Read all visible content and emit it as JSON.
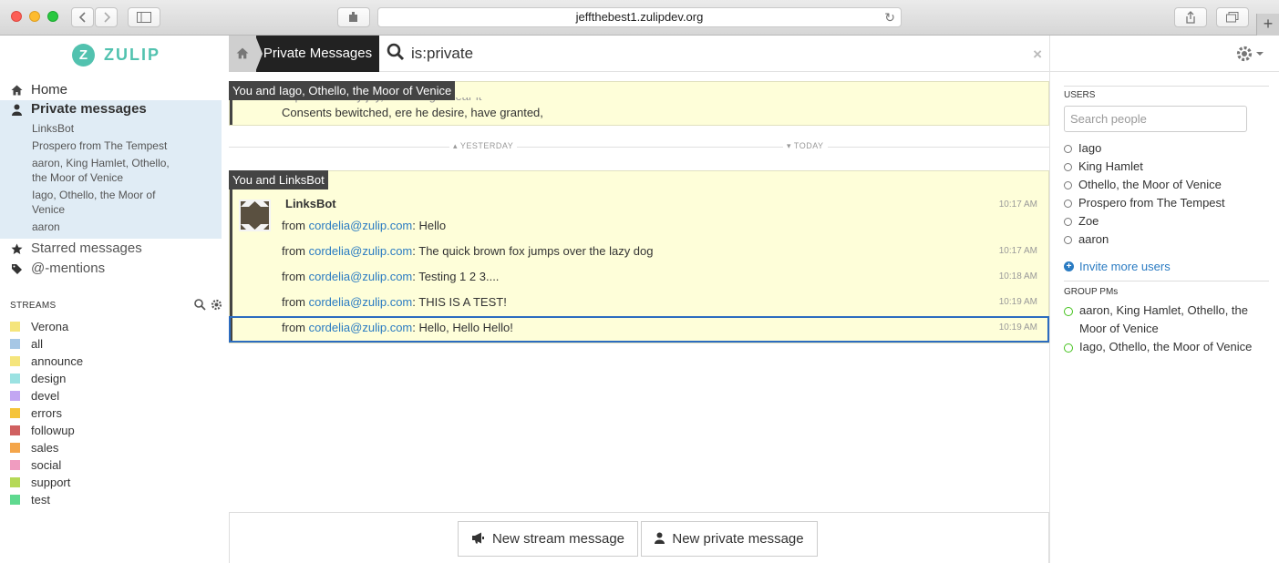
{
  "browser": {
    "url": "jeffthebest1.zulipdev.org",
    "back_icon": "chevron-left",
    "forward_icon": "chevron-right",
    "sidebar_icon": "sidebar",
    "reload_icon": "reload",
    "new_tab_icon": "plus"
  },
  "app": {
    "logo_letter": "Z",
    "name": "ZULIP"
  },
  "left_nav": {
    "home": "Home",
    "private_messages": "Private messages",
    "starred": "Starred messages",
    "mentions": "@-mentions",
    "pm_conversations": [
      "LinksBot",
      "Prospero from The Tempest",
      "aaron, King Hamlet, Othello, the Moor of Venice",
      "Iago, Othello, the Moor of Venice",
      "aaron"
    ]
  },
  "streams": {
    "header": "STREAMS",
    "items": [
      {
        "name": "Verona",
        "color": "#f5e57c"
      },
      {
        "name": "all",
        "color": "#a6c7e5"
      },
      {
        "name": "announce",
        "color": "#f5e57c"
      },
      {
        "name": "design",
        "color": "#9be2e2"
      },
      {
        "name": "devel",
        "color": "#c2a6f2"
      },
      {
        "name": "errors",
        "color": "#f5c43a"
      },
      {
        "name": "followup",
        "color": "#d06060"
      },
      {
        "name": "sales",
        "color": "#f4a54a"
      },
      {
        "name": "social",
        "color": "#f09cc0"
      },
      {
        "name": "support",
        "color": "#b5d957"
      },
      {
        "name": "test",
        "color": "#5fd98f"
      }
    ]
  },
  "topbar": {
    "tab_label": "Private Messages",
    "search_value": "is:private",
    "clear_icon": "×"
  },
  "messages": {
    "group1_recipients": "You and Iago, Othello, the Moor of Venice",
    "group1_partial": "Impatient of my joy, that I might hear it",
    "group1_last": "Consents bewitched, ere he desire, have granted,",
    "divider_left": "YESTERDAY",
    "divider_right": "TODAY",
    "group2_recipients": "You and LinksBot",
    "sender": "LinksBot",
    "rows": [
      {
        "prefix": "from ",
        "email": "cordelia@zulip.com",
        "text": ": Hello",
        "time": "10:17 AM"
      },
      {
        "prefix": "from ",
        "email": "cordelia@zulip.com",
        "text": ": The quick brown fox jumps over the lazy dog",
        "time": "10:17 AM"
      },
      {
        "prefix": "from ",
        "email": "cordelia@zulip.com",
        "text": ": Testing 1 2 3....",
        "time": "10:18 AM"
      },
      {
        "prefix": "from ",
        "email": "cordelia@zulip.com",
        "text": ": THIS IS A TEST!",
        "time": "10:19 AM"
      },
      {
        "prefix": "from ",
        "email": "cordelia@zulip.com",
        "text": ": Hello, Hello Hello!",
        "time": "10:19 AM"
      }
    ]
  },
  "compose": {
    "new_stream": "New stream message",
    "new_private": "New private message"
  },
  "right_sidebar": {
    "users_header": "USERS",
    "search_placeholder": "Search people",
    "users": [
      "Iago",
      "King Hamlet",
      "Othello, the Moor of Venice",
      "Prospero from The Tempest",
      "Zoe",
      "aaron"
    ],
    "invite": "Invite more users",
    "group_header": "GROUP PMs",
    "groups": [
      "aaron, King Hamlet, Othello, the Moor of Venice",
      "Iago, Othello, the Moor of Venice"
    ]
  }
}
